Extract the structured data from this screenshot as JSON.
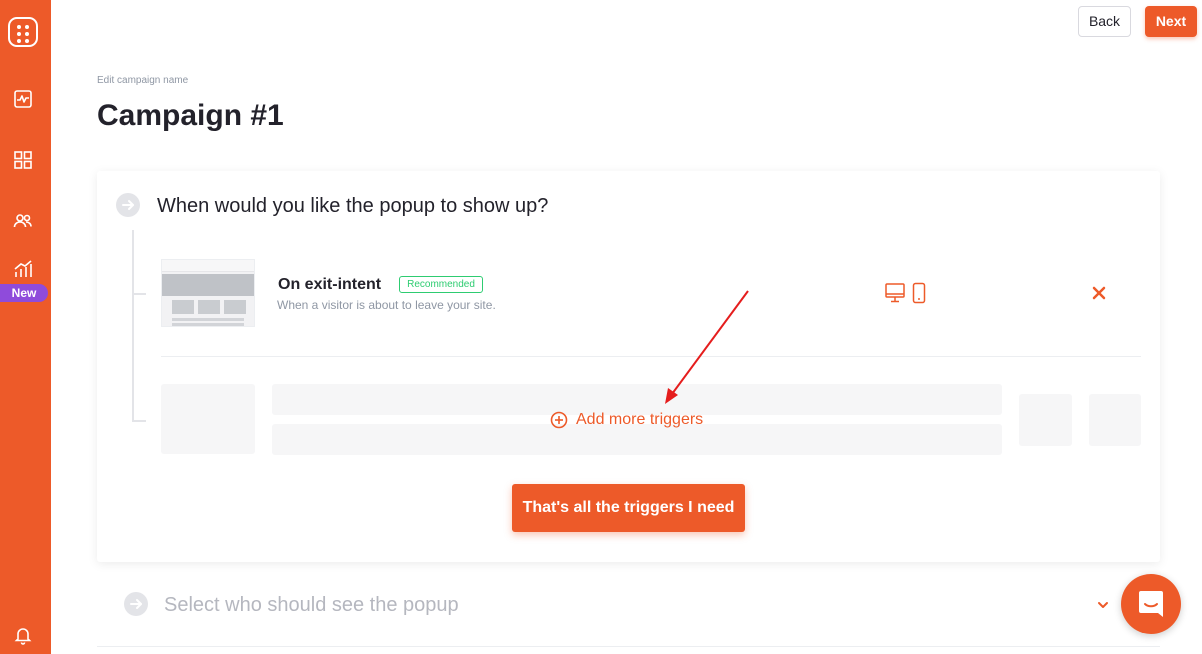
{
  "colors": {
    "accent": "#ed5a29",
    "badge_new": "#8f4bdb",
    "recommended": "#2ecc71",
    "muted": "#8f97a4"
  },
  "sidebar": {
    "logo_icon": "dice-logo-icon",
    "items": [
      {
        "icon": "analytics-icon"
      },
      {
        "icon": "grid-icon"
      },
      {
        "icon": "users-icon"
      },
      {
        "icon": "growth-chart-icon",
        "badge": "New"
      }
    ],
    "bottom_icon": "bell-icon"
  },
  "header": {
    "back_label": "Back",
    "next_label": "Next"
  },
  "campaign": {
    "edit_label": "Edit campaign name",
    "title": "Campaign #1"
  },
  "step1": {
    "question": "When would you like the popup to show up?",
    "trigger": {
      "name": "On exit-intent",
      "badge": "Recommended",
      "description": "When a visitor is about to leave your site.",
      "devices": [
        "desktop-icon",
        "mobile-icon"
      ]
    },
    "add_more_label": "Add more triggers",
    "done_label": "That's all the triggers I need"
  },
  "step2": {
    "question": "Select who should see the popup"
  }
}
